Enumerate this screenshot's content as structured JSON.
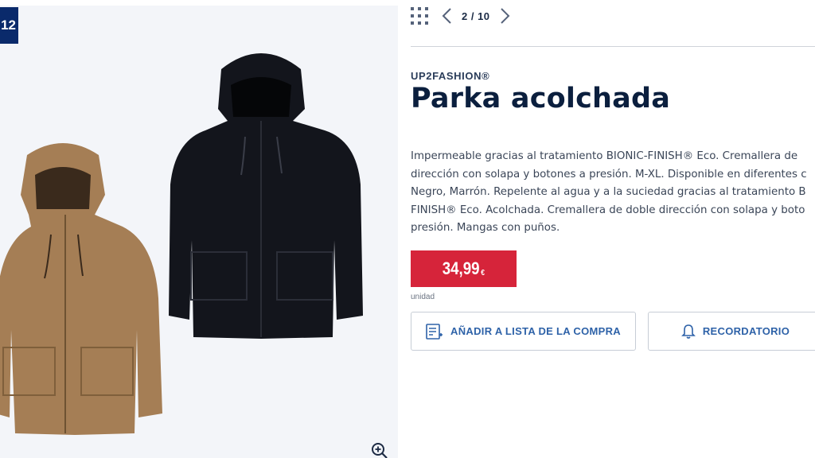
{
  "gallery": {
    "badge": "12"
  },
  "nav": {
    "pager": "2 / 10"
  },
  "product": {
    "brand": "UP2FASHION®",
    "title": "Parka acolchada",
    "description_lines": [
      "Impermeable gracias al tratamiento BIONIC-FINISH® Eco. Cremallera de",
      "dirección con solapa y botones a presión. M-XL. Disponible en diferentes c",
      "Negro, Marrón. Repelente al agua y a la suciedad gracias al tratamiento B",
      "FINISH® Eco. Acolchada. Cremallera de doble dirección con solapa y boto",
      "presión. Mangas con puños."
    ],
    "price": "34,99",
    "currency": "€",
    "unit": "unidad"
  },
  "actions": {
    "add_to_list": "AÑADIR A LISTA DE LA COMPRA",
    "reminder": "RECORDATORIO"
  },
  "colors": {
    "price_bg": "#d6243a",
    "badge_bg": "#0a2a6b",
    "button_text": "#2e62a8",
    "title": "#0b1f3e"
  },
  "icons": [
    "grid-icon",
    "chevron-left-icon",
    "chevron-right-icon",
    "zoom-in-icon",
    "shopping-list-icon",
    "bell-icon"
  ]
}
